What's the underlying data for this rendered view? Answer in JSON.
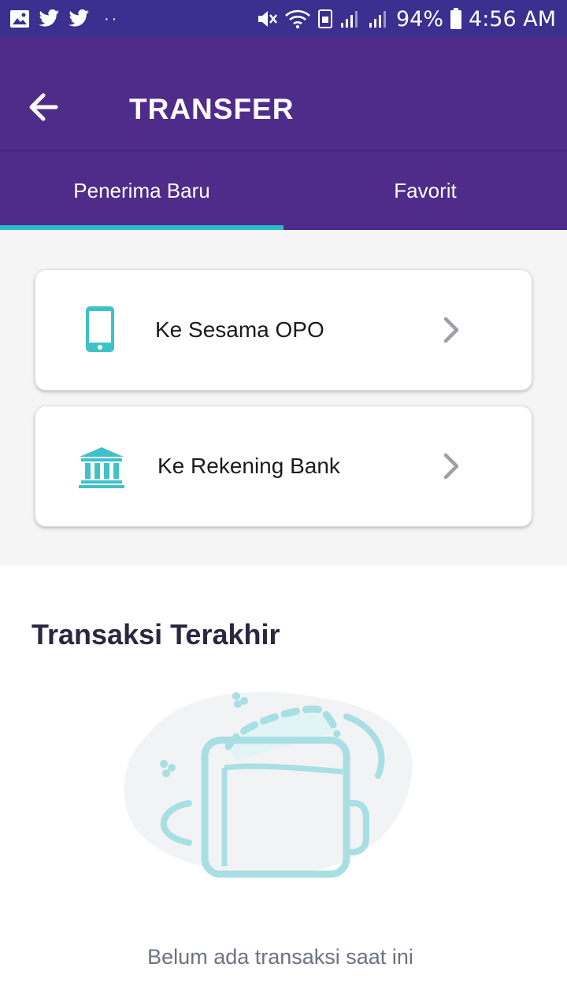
{
  "status_bar": {
    "battery": "94%",
    "time": "4:56 AM",
    "icons": [
      "gallery-icon",
      "twitter-icon",
      "twitter-icon",
      "mute-icon",
      "wifi-icon",
      "signal-icon",
      "battery-icon"
    ]
  },
  "app_bar": {
    "title": "TRANSFER",
    "back_icon": "back-arrow-icon"
  },
  "tabs": [
    {
      "label": "Penerima Baru",
      "active": true
    },
    {
      "label": "Favorit",
      "active": false
    }
  ],
  "options": [
    {
      "label": "Ke Sesama OPO",
      "icon": "phone-icon"
    },
    {
      "label": "Ke Rekening Bank",
      "icon": "bank-icon"
    }
  ],
  "recent": {
    "title": "Transaksi Terakhir",
    "empty_text": "Belum ada transaksi saat ini",
    "illustration": "empty-wallet-illustration"
  },
  "colors": {
    "status_bar": "#3b2f8f",
    "app_bar": "#4f2b8a",
    "accent": "#2bbcc9",
    "icon": "#3fc1c9",
    "chevron": "#9aa0a6"
  }
}
